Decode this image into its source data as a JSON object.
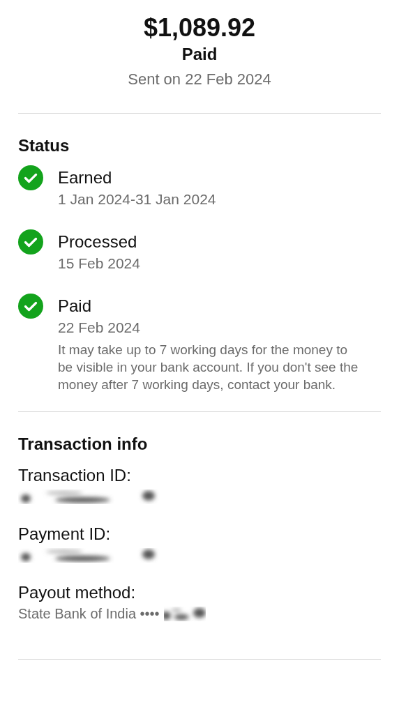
{
  "header": {
    "amount": "$1,089.92",
    "status": "Paid",
    "sent": "Sent on 22 Feb 2024"
  },
  "status": {
    "title": "Status",
    "steps": [
      {
        "label": "Earned",
        "date": "1 Jan 2024-31 Jan 2024",
        "done": true
      },
      {
        "label": "Processed",
        "date": "15 Feb 2024",
        "done": true
      },
      {
        "label": "Paid",
        "date": "22 Feb 2024",
        "done": true,
        "note": "It may take up to 7 working days for the money to be visible in your bank account. If you don't see the money after 7 working days, contact your bank."
      }
    ]
  },
  "transaction_info": {
    "title": "Transaction info",
    "fields": [
      {
        "label": "Transaction ID:",
        "redacted": true
      },
      {
        "label": "Payment ID:",
        "redacted": true
      },
      {
        "label": "Payout method:",
        "value": "State Bank of India ••••",
        "redacted": true
      }
    ]
  }
}
